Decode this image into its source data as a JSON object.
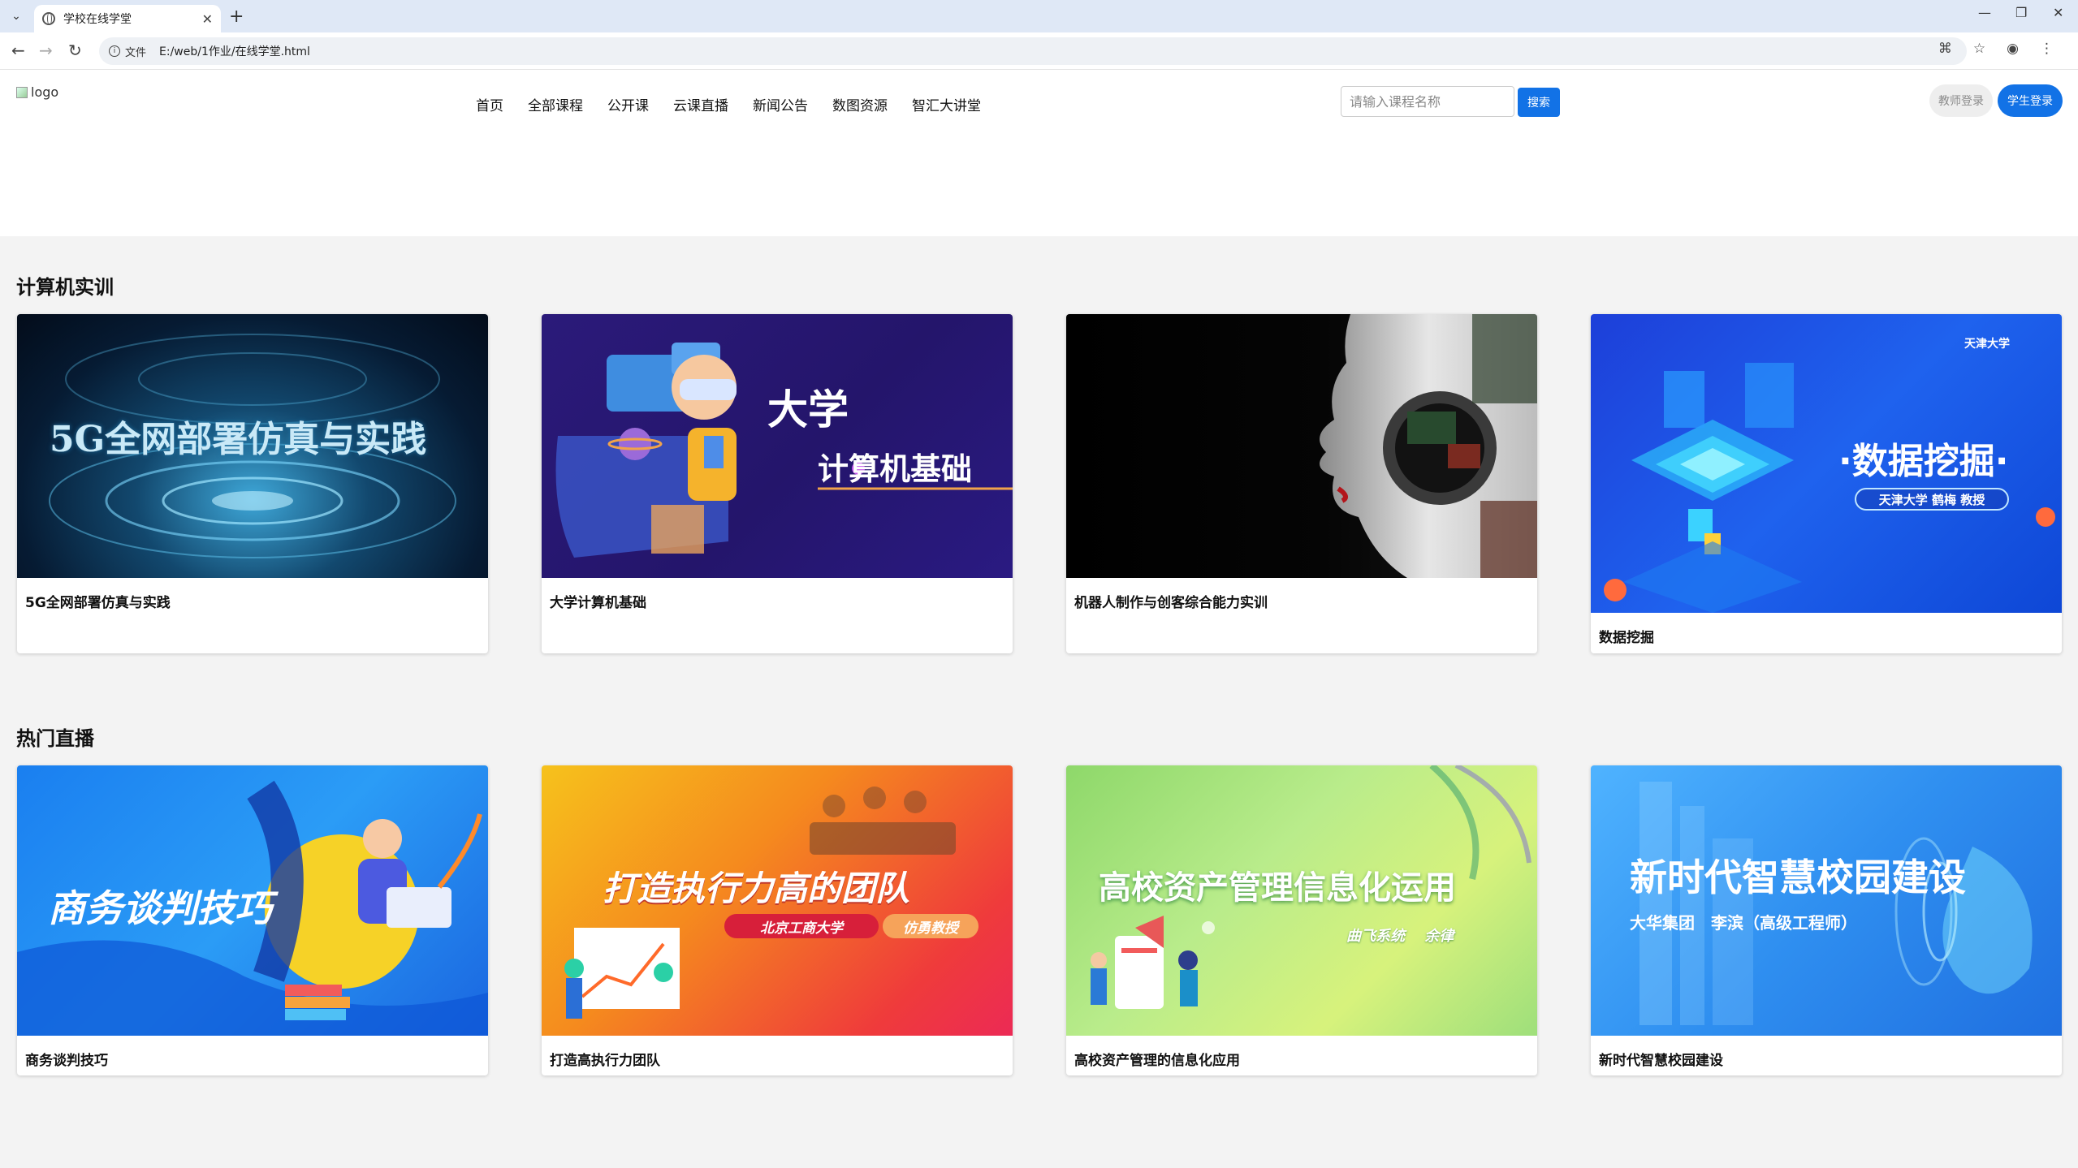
{
  "browser": {
    "tab_title": "学校在线学堂",
    "url_label": "文件",
    "url": "E:/web/1作业/在线学堂.html"
  },
  "header": {
    "logo_alt": "logo",
    "nav": [
      "首页",
      "全部课程",
      "公开课",
      "云课直播",
      "新闻公告",
      "数图资源",
      "智汇大讲堂"
    ],
    "search_placeholder": "请输入课程名称",
    "search_button": "搜索",
    "teacher_login": "教师登录",
    "student_login": "学生登录"
  },
  "sections": [
    {
      "title": "计算机实训",
      "cards": [
        {
          "title": "5G全网部署仿真与实践",
          "image_text": "5G全网部署仿真与实践"
        },
        {
          "title": "大学计算机基础",
          "image_text_1": "大学",
          "image_text_2": "计算机基础"
        },
        {
          "title": "机器人制作与创客综合能力实训"
        },
        {
          "title": "数据挖掘",
          "image_text": "·数据挖掘·",
          "image_sub": "天津大学 鹤梅 教授",
          "image_logo": "天津大学"
        }
      ]
    },
    {
      "title": "热门直播",
      "cards": [
        {
          "title": "商务谈判技巧",
          "image_text": "商务谈判技巧"
        },
        {
          "title": "打造高执行力团队",
          "image_text": "打造执行力高的团队",
          "image_sub_1": "北京工商大学",
          "image_sub_2": "仿勇教授"
        },
        {
          "title": "高校资产管理的信息化应用",
          "image_text": "高校资产管理信息化运用",
          "image_sub": "曲飞系统　 余律"
        },
        {
          "title": "新时代智慧校园建设",
          "image_text": "新时代智慧校园建设",
          "image_sub": "大华集团　李滨（高级工程师）"
        }
      ]
    }
  ]
}
